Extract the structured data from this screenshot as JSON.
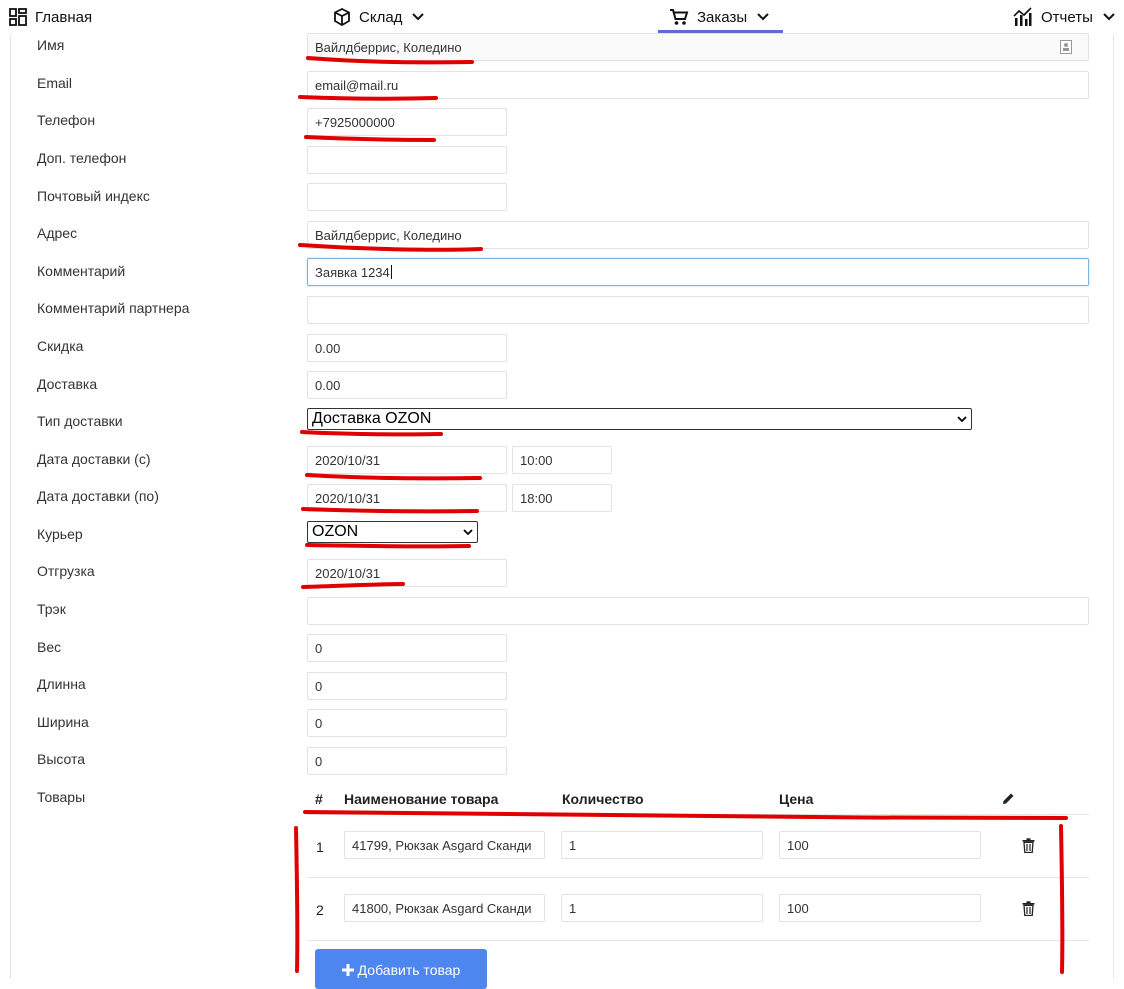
{
  "nav": {
    "home": "Главная",
    "warehouse": "Склад",
    "orders": "Заказы",
    "reports": "Отчеты"
  },
  "form": {
    "name_label": "Имя",
    "name_value": "Вайлдберрис, Коледино",
    "email_label": "Email",
    "email_value": "email@mail.ru",
    "phone_label": "Телефон",
    "phone_value": "+7925000000",
    "alt_phone_label": "Доп. телефон",
    "alt_phone_value": "",
    "zip_label": "Почтовый индекс",
    "zip_value": "",
    "address_label": "Адрес",
    "address_value": "Вайлдберрис, Коледино",
    "comment_label": "Комментарий",
    "comment_value": "Заявка 1234",
    "partner_comment_label": "Комментарий партнера",
    "partner_comment_value": "",
    "discount_label": "Скидка",
    "discount_value": "0.00",
    "delivery_label": "Доставка",
    "delivery_value": "0.00",
    "delivery_type_label": "Тип доставки",
    "delivery_type_value": "Доставка OZON",
    "delivery_from_label": "Дата доставки (с)",
    "delivery_from_date": "2020/10/31",
    "delivery_from_time": "10:00",
    "delivery_to_label": "Дата доставки (по)",
    "delivery_to_date": "2020/10/31",
    "delivery_to_time": "18:00",
    "courier_label": "Курьер",
    "courier_value": "OZON",
    "shipment_label": "Отгрузка",
    "shipment_value": "2020/10/31",
    "track_label": "Трэк",
    "track_value": "",
    "weight_label": "Вес",
    "weight_value": "0",
    "length_label": "Длинна",
    "length_value": "0",
    "width_label": "Ширина",
    "width_value": "0",
    "height_label": "Высота",
    "height_value": "0",
    "goods_label": "Товары"
  },
  "goods_table": {
    "headers": {
      "num": "#",
      "name": "Наименование товара",
      "qty": "Количество",
      "price": "Цена"
    },
    "rows": [
      {
        "num": "1",
        "name": "41799, Рюкзак Asgard Сканди",
        "qty": "1",
        "price": "100"
      },
      {
        "num": "2",
        "name": "41800, Рюкзак Asgard Сканди",
        "qty": "1",
        "price": "100"
      }
    ],
    "add_button": "Добавить товар"
  },
  "icons": {
    "home": "grid-icon",
    "warehouse": "box-icon",
    "orders": "cart-icon",
    "reports": "chart-icon",
    "edit": "pencil-icon",
    "delete": "trash-icon",
    "add": "plus-icon",
    "contact": "contact-card-icon"
  },
  "colors": {
    "accent": "#5c6bd6",
    "button": "#4e86f0",
    "annotation": "#e00000"
  }
}
